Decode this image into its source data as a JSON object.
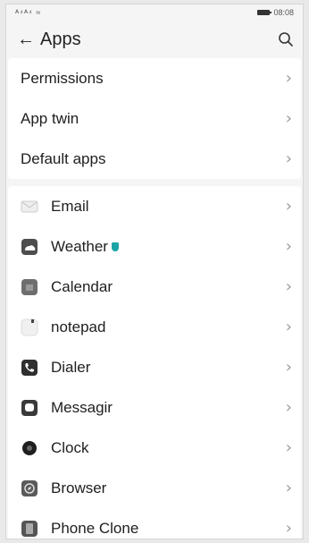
{
  "status_bar": {
    "signal_text": "ᴬ⁴ᴬ⁴ ≈",
    "time": "08:08"
  },
  "header": {
    "title": "Apps"
  },
  "settings_group": [
    {
      "label": "Permissions"
    },
    {
      "label": "App twin"
    },
    {
      "label": "Default apps"
    }
  ],
  "apps": [
    {
      "label": "Email",
      "icon": "email-icon"
    },
    {
      "label": "Weather",
      "icon": "weather-icon",
      "badge": "shield-badge-icon"
    },
    {
      "label": "Calendar",
      "icon": "calendar-icon"
    },
    {
      "label": "notepad",
      "icon": "notepad-icon"
    },
    {
      "label": "Dialer",
      "icon": "dialer-icon"
    },
    {
      "label": "Messagir",
      "icon": "messaging-icon"
    },
    {
      "label": "Clock",
      "icon": "clock-icon"
    },
    {
      "label": "Browser",
      "icon": "browser-icon"
    },
    {
      "label": "Phone Clone",
      "icon": "phone-clone-icon"
    }
  ],
  "chevron": "›"
}
